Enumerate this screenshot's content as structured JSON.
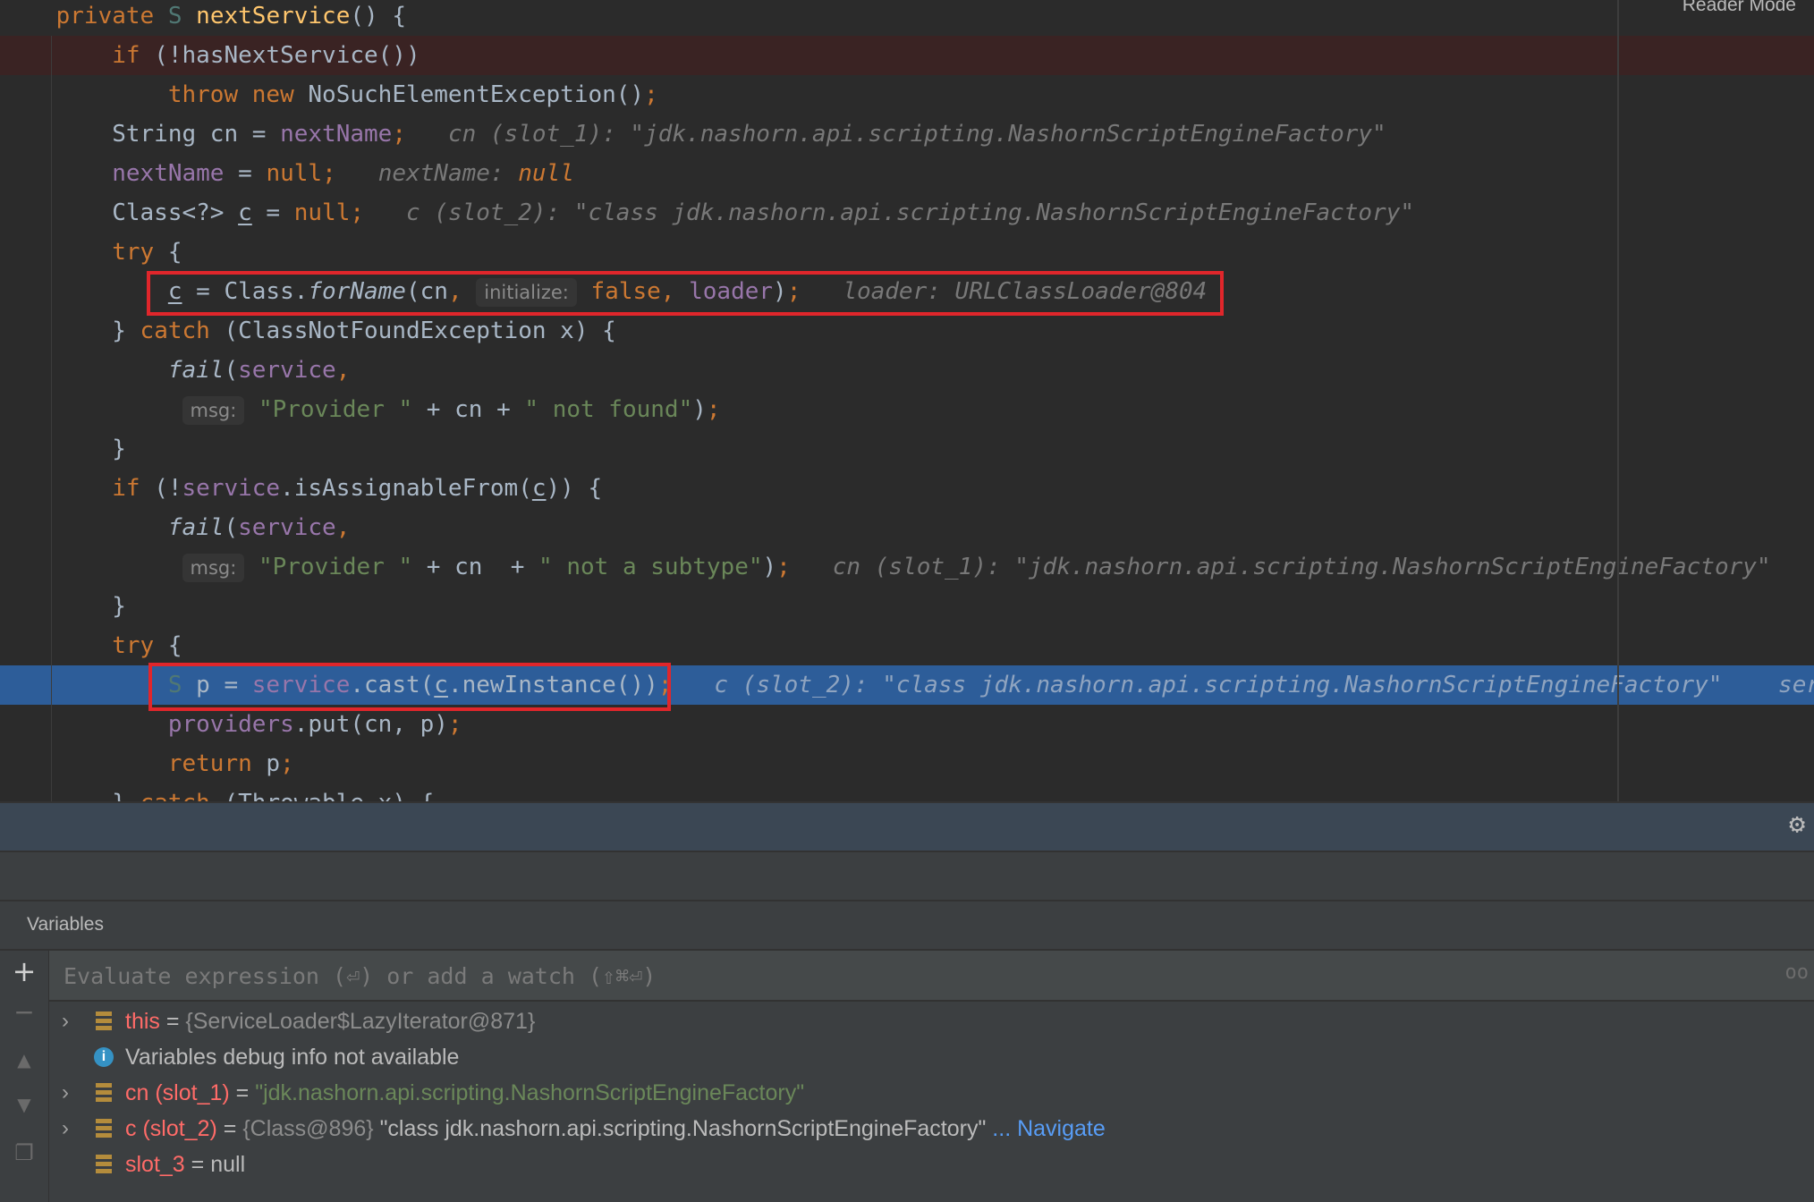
{
  "editor": {
    "reader_mode": "Reader Mode",
    "breakpoint_line": 1,
    "current_line": 17,
    "lines": [
      [
        [
          "    ",
          "p"
        ],
        [
          "private",
          "kw"
        ],
        [
          " ",
          "p"
        ],
        [
          "S",
          "tparam"
        ],
        [
          " ",
          "p"
        ],
        [
          "nextService",
          "fn"
        ],
        [
          "() {",
          "p"
        ]
      ],
      [
        [
          "        ",
          "p"
        ],
        [
          "if",
          "kw"
        ],
        [
          " (!hasNextService())",
          "p"
        ]
      ],
      [
        [
          "            ",
          "p"
        ],
        [
          "throw",
          "kw"
        ],
        [
          " ",
          "p"
        ],
        [
          "new",
          "kw"
        ],
        [
          " NoSuchElementException()",
          "p"
        ],
        [
          ";",
          "kw"
        ]
      ],
      [
        [
          "        String cn = ",
          "p"
        ],
        [
          "nextName",
          "field"
        ],
        [
          ";",
          "kw"
        ],
        [
          "   ",
          "p"
        ],
        [
          "cn (slot_1): \"jdk.nashorn.api.scripting.NashornScriptEngineFactory\"",
          "hint"
        ]
      ],
      [
        [
          "        ",
          "p"
        ],
        [
          "nextName",
          "field"
        ],
        [
          " = ",
          "p"
        ],
        [
          "null",
          "kw"
        ],
        [
          ";",
          "kw"
        ],
        [
          "   ",
          "p"
        ],
        [
          "nextName: ",
          "hint"
        ],
        [
          "null",
          "hintnull"
        ]
      ],
      [
        [
          "        Class<?> ",
          "p"
        ],
        [
          "c",
          "u"
        ],
        [
          " = ",
          "p"
        ],
        [
          "null",
          "kw"
        ],
        [
          ";",
          "kw"
        ],
        [
          "   ",
          "p"
        ],
        [
          "c (slot_2): \"class jdk.nashorn.api.scripting.NashornScriptEngineFactory\"",
          "hint"
        ]
      ],
      [
        [
          "        ",
          "p"
        ],
        [
          "try",
          "kw"
        ],
        [
          " {",
          "p"
        ]
      ],
      [
        [
          "            ",
          "p"
        ],
        [
          "c",
          "u"
        ],
        [
          " = Class.",
          "p"
        ],
        [
          "forName",
          "it"
        ],
        [
          "(cn",
          "p"
        ],
        [
          ",",
          "kw"
        ],
        [
          " ",
          "p"
        ],
        [
          "initialize:",
          "chip"
        ],
        [
          " ",
          "p"
        ],
        [
          "false",
          "kw"
        ],
        [
          ",",
          "kw"
        ],
        [
          " ",
          "p"
        ],
        [
          "loader",
          "field"
        ],
        [
          ")",
          "p"
        ],
        [
          ";",
          "kw"
        ],
        [
          "   ",
          "p"
        ],
        [
          "loader: URLClassLoader@804",
          "hint"
        ]
      ],
      [
        [
          "        } ",
          "p"
        ],
        [
          "catch",
          "kw"
        ],
        [
          " (ClassNotFoundException x) {",
          "p"
        ]
      ],
      [
        [
          "            ",
          "p"
        ],
        [
          "fail",
          "it"
        ],
        [
          "(",
          "p"
        ],
        [
          "service",
          "field"
        ],
        [
          ",",
          "kw"
        ]
      ],
      [
        [
          "             ",
          "p"
        ],
        [
          "msg:",
          "chip"
        ],
        [
          " ",
          "p"
        ],
        [
          "\"Provider \"",
          "str"
        ],
        [
          " + cn + ",
          "p"
        ],
        [
          "\" not found\"",
          "str"
        ],
        [
          ")",
          "p"
        ],
        [
          ";",
          "kw"
        ]
      ],
      [
        [
          "        }",
          "p"
        ]
      ],
      [
        [
          "        ",
          "p"
        ],
        [
          "if",
          "kw"
        ],
        [
          " (!",
          "p"
        ],
        [
          "service",
          "field"
        ],
        [
          ".isAssignableFrom(",
          "p"
        ],
        [
          "c",
          "u"
        ],
        [
          ")) {",
          "p"
        ]
      ],
      [
        [
          "            ",
          "p"
        ],
        [
          "fail",
          "it"
        ],
        [
          "(",
          "p"
        ],
        [
          "service",
          "field"
        ],
        [
          ",",
          "kw"
        ]
      ],
      [
        [
          "             ",
          "p"
        ],
        [
          "msg:",
          "chip"
        ],
        [
          " ",
          "p"
        ],
        [
          "\"Provider \"",
          "str"
        ],
        [
          " + cn  + ",
          "p"
        ],
        [
          "\" not a subtype\"",
          "str"
        ],
        [
          ")",
          "p"
        ],
        [
          ";",
          "kw"
        ],
        [
          "   ",
          "p"
        ],
        [
          "cn (slot_1): \"jdk.nashorn.api.scripting.NashornScriptEngineFactory\"",
          "hint"
        ]
      ],
      [
        [
          "        }",
          "p"
        ]
      ],
      [
        [
          "        ",
          "p"
        ],
        [
          "try",
          "kw"
        ],
        [
          " {",
          "p"
        ]
      ],
      [
        [
          "            ",
          "p"
        ],
        [
          "S",
          "tparam"
        ],
        [
          " p = ",
          "p"
        ],
        [
          "service",
          "field"
        ],
        [
          ".cast(",
          "p"
        ],
        [
          "c",
          "u"
        ],
        [
          ".newInstance())",
          "p"
        ],
        [
          ";",
          "kw"
        ],
        [
          "   ",
          "p"
        ],
        [
          "c (slot_2): \"class jdk.nashorn.api.scripting.NashornScriptEngineFactory\"",
          "hint"
        ],
        [
          "    ",
          "p"
        ],
        [
          "serv",
          "hint"
        ]
      ],
      [
        [
          "            ",
          "p"
        ],
        [
          "providers",
          "field"
        ],
        [
          ".put(cn, p)",
          "p"
        ],
        [
          ";",
          "kw"
        ]
      ],
      [
        [
          "            ",
          "p"
        ],
        [
          "return",
          "kw"
        ],
        [
          " p",
          "p"
        ],
        [
          ";",
          "kw"
        ]
      ],
      [
        [
          "        } ",
          "p"
        ],
        [
          "catch",
          "kw"
        ],
        [
          " (Throwable x) {",
          "p"
        ]
      ]
    ]
  },
  "debug": {
    "gear_icon": "gear-icon",
    "variables_title": "Variables",
    "eval_placeholder": "Evaluate expression (⏎) or add a watch (⇧⌘⏎)",
    "toolbar": {
      "add": "+",
      "remove": "−",
      "up": "▲",
      "down": "▼"
    },
    "variables": [
      {
        "expandable": true,
        "icon": "field-icon",
        "name": "this",
        "eq": " = ",
        "obj": "{ServiceLoader$LazyIterator@871}",
        "value": "",
        "value_kind": "",
        "link": ""
      },
      {
        "expandable": false,
        "icon": "info-icon",
        "name": "",
        "eq": "",
        "obj": "",
        "value": "Variables debug info not available",
        "value_kind": "plain",
        "link": ""
      },
      {
        "expandable": true,
        "icon": "field-icon",
        "name": "cn (slot_1)",
        "eq": " = ",
        "obj": "",
        "value": "\"jdk.nashorn.api.scripting.NashornScriptEngineFactory\"",
        "value_kind": "str",
        "link": ""
      },
      {
        "expandable": true,
        "icon": "field-icon",
        "name": "c (slot_2)",
        "eq": " = ",
        "obj": "{Class@896} ",
        "value": "\"class jdk.nashorn.api.scripting.NashornScriptEngineFactory\"",
        "value_kind": "plain",
        "link": " ... Navigate"
      },
      {
        "expandable": false,
        "icon": "field-icon",
        "name": "slot_3",
        "eq": " = ",
        "obj": "",
        "value": "null",
        "value_kind": "plain",
        "link": ""
      }
    ]
  },
  "colors": {
    "breakpoint_line": "#3a2323",
    "current_line": "#2d5d99",
    "highlight_box": "#e0262b"
  }
}
